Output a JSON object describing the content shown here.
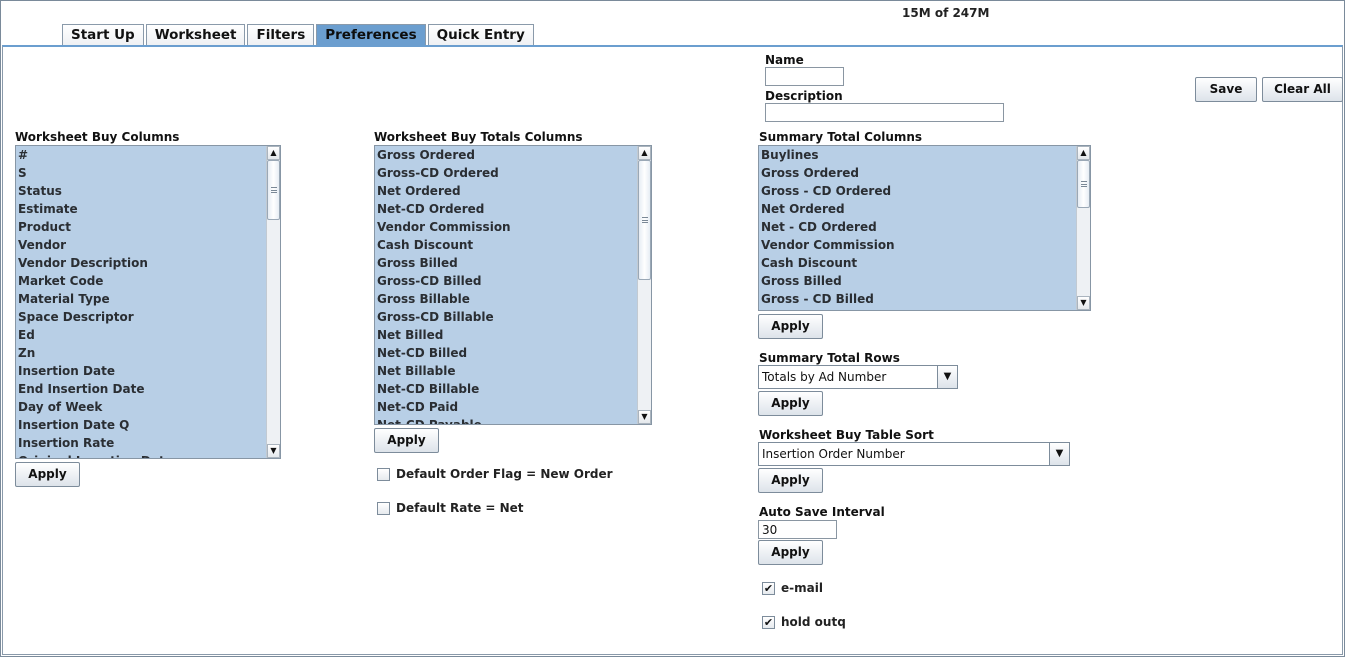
{
  "memory_status": "15M of 247M",
  "tabs": [
    {
      "label": "Start Up"
    },
    {
      "label": "Worksheet"
    },
    {
      "label": "Filters"
    },
    {
      "label": "Preferences",
      "active": true
    },
    {
      "label": "Quick Entry"
    }
  ],
  "header": {
    "name_label": "Name",
    "name_value": "",
    "description_label": "Description",
    "description_value": "",
    "save_label": "Save",
    "clear_all_label": "Clear All"
  },
  "buy_columns": {
    "label": "Worksheet Buy Columns",
    "items": [
      "#",
      "S",
      "Status",
      "Estimate",
      "Product",
      "Vendor",
      "Vendor Description",
      "Market Code",
      "Material Type",
      "Space Descriptor",
      "Ed",
      "Zn",
      "Insertion Date",
      "End Insertion Date",
      "Day of Week",
      "Insertion Date Q",
      "Insertion Rate",
      "Original Insertion Date"
    ],
    "apply_label": "Apply"
  },
  "buy_totals_columns": {
    "label": "Worksheet Buy Totals Columns",
    "items": [
      "Gross Ordered",
      "Gross-CD Ordered",
      "Net Ordered",
      "Net-CD Ordered",
      "Vendor Commission",
      "Cash Discount",
      "Gross Billed",
      "Gross-CD Billed",
      "Gross Billable",
      "Gross-CD Billable",
      "Net Billed",
      "Net-CD Billed",
      "Net Billable",
      "Net-CD Billable",
      "Net-CD Paid",
      "Net-CD Payable"
    ],
    "apply_label": "Apply",
    "default_order_flag_label": "Default Order Flag = New Order",
    "default_order_flag_checked": false,
    "default_rate_label": "Default Rate = Net",
    "default_rate_checked": false
  },
  "summary_total_columns": {
    "label": "Summary Total Columns",
    "items": [
      "Buylines",
      "Gross Ordered",
      "Gross - CD Ordered",
      "Net Ordered",
      "Net - CD Ordered",
      "Vendor Commission",
      "Cash Discount",
      "Gross Billed",
      "Gross - CD Billed"
    ],
    "apply_label": "Apply"
  },
  "summary_total_rows": {
    "label": "Summary Total Rows",
    "selected": "Totals by Ad Number",
    "apply_label": "Apply"
  },
  "buy_table_sort": {
    "label": "Worksheet Buy Table Sort",
    "selected": "Insertion Order Number",
    "apply_label": "Apply"
  },
  "auto_save": {
    "label": "Auto Save Interval",
    "value": "30",
    "apply_label": "Apply"
  },
  "options": [
    {
      "label": "e-mail",
      "checked": true,
      "mark": "✔"
    },
    {
      "label": "hold outq",
      "checked": true,
      "mark": "✔"
    }
  ],
  "icons": {
    "scroll_up": "▲",
    "scroll_down": "▼",
    "combo_arrow": "▼"
  }
}
